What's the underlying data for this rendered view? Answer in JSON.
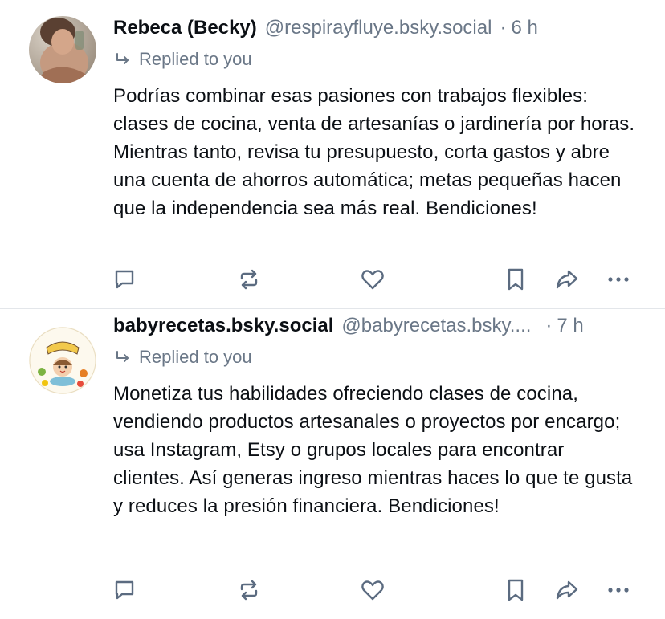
{
  "posts": [
    {
      "author_name": "Rebeca (Becky)",
      "handle": "@respirayfluye.bsky.social",
      "separator": "·",
      "time": "6 h",
      "reply_label": "Replied to you",
      "text": "Podrías combinar esas pasiones con trabajos flexibles: clases de cocina, venta de artesanías o jardinería por horas. Mientras tanto, revisa tu presupuesto, corta gastos y abre una cuenta de ahorros automática; metas pequeñas hacen que la independencia sea más real. Bendiciones!",
      "avatar": "photo-avatar"
    },
    {
      "author_name": "babyrecetas.bsky.social",
      "handle": "@babyrecetas.bsky....",
      "separator": "·",
      "time": "7 h",
      "reply_label": "Replied to you",
      "text": "Monetiza tus habilidades ofreciendo clases de cocina, vendiendo productos artesanales o proyectos por encargo; usa Instagram, Etsy o grupos locales para encontrar clientes. Así generas ingreso mientras haces lo que te gusta y reduces la presión financiera. Bendiciones!",
      "avatar": "baby-recetas-logo",
      "avatar_logo_text": "BABY RECETAS"
    }
  ],
  "icons": {
    "reply": "speech-bubble-icon",
    "repost": "repost-icon",
    "like": "heart-icon",
    "save": "bookmark-icon",
    "share": "share-arrow-icon",
    "more": "more-dots-icon"
  },
  "colors": {
    "text": "#0b0f14",
    "muted": "#6a7787",
    "icon": "#5b6b80",
    "divider": "#e3e6ea"
  }
}
